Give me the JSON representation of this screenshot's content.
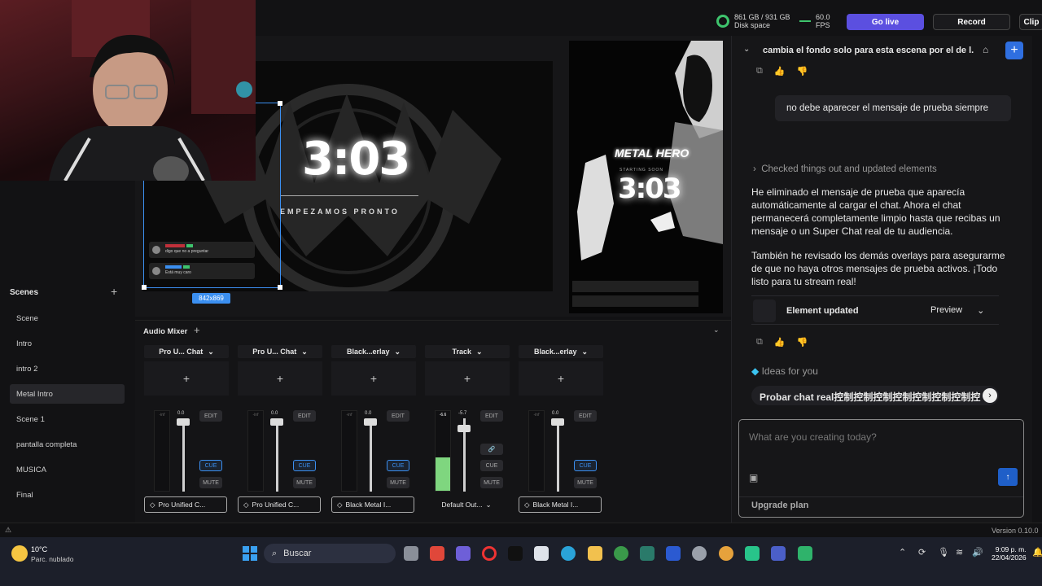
{
  "topbar": {
    "disk_value": "861 GB / 931 GB",
    "disk_label": "Disk space",
    "fps_value": "60.0",
    "fps_label": "FPS",
    "go_live": "Go live",
    "record": "Record",
    "clip": "Clip"
  },
  "preview": {
    "h_timer": "3:03",
    "h_subtitle": "EMPEZAMOS PRONTO",
    "selection_size": "842x869",
    "chat_msg_1": "digo que no a preguntar",
    "chat_msg_2": "Está muy caro",
    "v_title": "METAL HERO",
    "v_subtitle": "STARTING SOON",
    "v_timer": "3:03"
  },
  "scenes": {
    "header": "Scenes",
    "items": [
      "Scene",
      "Intro",
      "intro 2",
      "Metal Intro",
      "Scene 1",
      "pantalla completa",
      "MUSICA",
      "Final"
    ],
    "selected": "Metal Intro"
  },
  "mixer": {
    "title": "Audio Mixer",
    "channels": [
      {
        "name": "Pro U... Chat",
        "level": "0.0",
        "output": "Pro Unified C..."
      },
      {
        "name": "Pro U... Chat",
        "level": "0.0",
        "output": "Pro Unified C..."
      },
      {
        "name": "Black...erlay",
        "level": "0.0",
        "output": "Black Metal I..."
      },
      {
        "name": "Track",
        "level": "-5.7",
        "peak": "-6.6",
        "output": "Default Out..."
      },
      {
        "name": "Black...erlay",
        "level": "0.0",
        "output": "Black Metal I..."
      }
    ],
    "edit": "EDIT",
    "cue": "CUE",
    "mute": "MUTE",
    "meter_min": "-inf"
  },
  "chat": {
    "title": "cambia el fondo solo para esta escena por el de l...",
    "user_msg": "no debe aparecer el mensaje de prueba siempre",
    "checked": "Checked things out and updated elements",
    "para1": "He eliminado el mensaje de prueba que aparecía automáticamente al cargar el chat. Ahora el chat permanecerá completamente limpio hasta que recibas un mensaje o un Super Chat real de tu audiencia.",
    "para2": "También he revisado los demás overlays para asegurarme de que no haya otros mensajes de prueba activos. ¡Todo listo para tu stream real!",
    "element_updated": "Element updated",
    "preview_btn": "Preview",
    "ideas": "Ideas for you",
    "suggestion": "Probar chat real控制控制控制控制控制控制控制控",
    "input_placeholder": "What are you creating today?",
    "upgrade": "Upgrade plan"
  },
  "footer": {
    "version": "Version 0.10.0"
  },
  "taskbar": {
    "weather_temp": "10°C",
    "weather_desc": "Parc. nublado",
    "search": "Buscar",
    "time": "9:09 p. m.",
    "date": "22/04/2026"
  },
  "colors": {
    "accent_blue": "#3b5bdb",
    "go_live": "#5b4fe0",
    "green": "#3ec46d"
  }
}
